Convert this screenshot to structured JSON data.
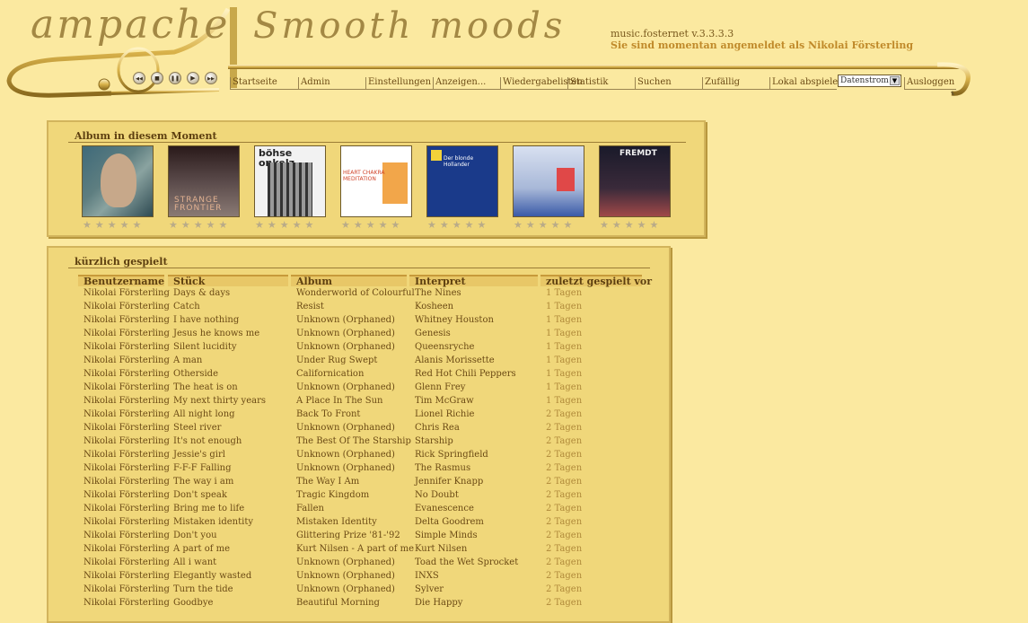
{
  "header": {
    "logo_text": "ampache",
    "tagline": "Smooth moods",
    "version": "music.fosternet v.3.3.3.3",
    "login_message": "Sie sind momentan angemeldet als Nikolai Försterling"
  },
  "player": {
    "buttons": [
      "previous",
      "stop",
      "pause",
      "play",
      "next"
    ],
    "glyphs": [
      "◀◀",
      "■",
      "❚❚",
      "▶",
      "▶▶"
    ]
  },
  "menu": {
    "items": [
      "Startseite",
      "Admin",
      "Einstellungen",
      "Anzeigen...",
      "Wiedergabelisten",
      "Statistik",
      "Suchen",
      "Zufällig",
      "Lokal abspielen"
    ],
    "stream_select": "Datenstrom",
    "logout": "Ausloggen"
  },
  "albums_panel": {
    "title": "Album in diesem Moment",
    "covers": [
      {
        "alt": "",
        "colors": [
          "#3f6a7a",
          "#8aa3a0"
        ]
      },
      {
        "alt": "STRANGE FRONTIER",
        "colors": [
          "#2a1a1a",
          "#8a7a74"
        ]
      },
      {
        "alt": "böhse onkelz",
        "colors": [
          "#f2f2f2",
          "#222222"
        ]
      },
      {
        "alt": "HEART CHAKRA MEDITATION",
        "colors": [
          "#ffffff",
          "#e07a2a"
        ]
      },
      {
        "alt": "Der blonde Hollander",
        "colors": [
          "#1a3a8a",
          "#ffffff"
        ]
      },
      {
        "alt": "",
        "colors": [
          "#c8d4e8",
          "#3a5aa8"
        ]
      },
      {
        "alt": "FREMDT",
        "colors": [
          "#1a1a2a",
          "#a04848"
        ]
      }
    ]
  },
  "recent_panel": {
    "title": "kürzlich gespielt",
    "columns": [
      "Benutzername",
      "Stück",
      "Album",
      "Interpret",
      "zuletzt gespielt vor"
    ],
    "rows": [
      [
        "Nikolai Försterling",
        "Days & days",
        "Wonderworld of Colourful",
        "The Nines",
        "1 Tagen"
      ],
      [
        "Nikolai Försterling",
        "Catch",
        "Resist",
        "Kosheen",
        "1 Tagen"
      ],
      [
        "Nikolai Försterling",
        "I have nothing",
        "Unknown (Orphaned)",
        "Whitney Houston",
        "1 Tagen"
      ],
      [
        "Nikolai Försterling",
        "Jesus he knows me",
        "Unknown (Orphaned)",
        "Genesis",
        "1 Tagen"
      ],
      [
        "Nikolai Försterling",
        "Silent lucidity",
        "Unknown (Orphaned)",
        "Queensryche",
        "1 Tagen"
      ],
      [
        "Nikolai Försterling",
        "A man",
        "Under Rug Swept",
        "Alanis Morissette",
        "1 Tagen"
      ],
      [
        "Nikolai Försterling",
        "Otherside",
        "Californication",
        "Red Hot Chili Peppers",
        "1 Tagen"
      ],
      [
        "Nikolai Försterling",
        "The heat is on",
        "Unknown (Orphaned)",
        "Glenn Frey",
        "1 Tagen"
      ],
      [
        "Nikolai Försterling",
        "My next thirty years",
        "A Place In The Sun",
        "Tim McGraw",
        "1 Tagen"
      ],
      [
        "Nikolai Försterling",
        "All night long",
        "Back To Front",
        "Lionel Richie",
        "2 Tagen"
      ],
      [
        "Nikolai Försterling",
        "Steel river",
        "Unknown (Orphaned)",
        "Chris Rea",
        "2 Tagen"
      ],
      [
        "Nikolai Försterling",
        "It's not enough",
        "The Best Of The Starship",
        "Starship",
        "2 Tagen"
      ],
      [
        "Nikolai Försterling",
        "Jessie's girl",
        "Unknown (Orphaned)",
        "Rick Springfield",
        "2 Tagen"
      ],
      [
        "Nikolai Försterling",
        "F-F-F Falling",
        "Unknown (Orphaned)",
        "The Rasmus",
        "2 Tagen"
      ],
      [
        "Nikolai Försterling",
        "The way i am",
        "The Way I Am",
        "Jennifer Knapp",
        "2 Tagen"
      ],
      [
        "Nikolai Försterling",
        "Don't speak",
        "Tragic Kingdom",
        "No Doubt",
        "2 Tagen"
      ],
      [
        "Nikolai Försterling",
        "Bring me to life",
        "Fallen",
        "Evanescence",
        "2 Tagen"
      ],
      [
        "Nikolai Försterling",
        "Mistaken identity",
        "Mistaken Identity",
        "Delta Goodrem",
        "2 Tagen"
      ],
      [
        "Nikolai Försterling",
        "Don't you",
        "Glittering Prize '81-'92",
        "Simple Minds",
        "2 Tagen"
      ],
      [
        "Nikolai Försterling",
        "A part of me",
        "Kurt Nilsen - A part of me",
        "Kurt Nilsen",
        "2 Tagen"
      ],
      [
        "Nikolai Försterling",
        "All i want",
        "Unknown (Orphaned)",
        "Toad the Wet Sprocket",
        "2 Tagen"
      ],
      [
        "Nikolai Försterling",
        "Elegantly wasted",
        "Unknown (Orphaned)",
        "INXS",
        "2 Tagen"
      ],
      [
        "Nikolai Försterling",
        "Turn the tide",
        "Unknown (Orphaned)",
        "Sylver",
        "2 Tagen"
      ],
      [
        "Nikolai Försterling",
        "Goodbye",
        "Beautiful Morning",
        "Die Happy",
        "2 Tagen"
      ]
    ]
  },
  "colors": {
    "background": "#fbe9a0",
    "panel": "#f0d77a",
    "days_text": "#b08a3a"
  }
}
